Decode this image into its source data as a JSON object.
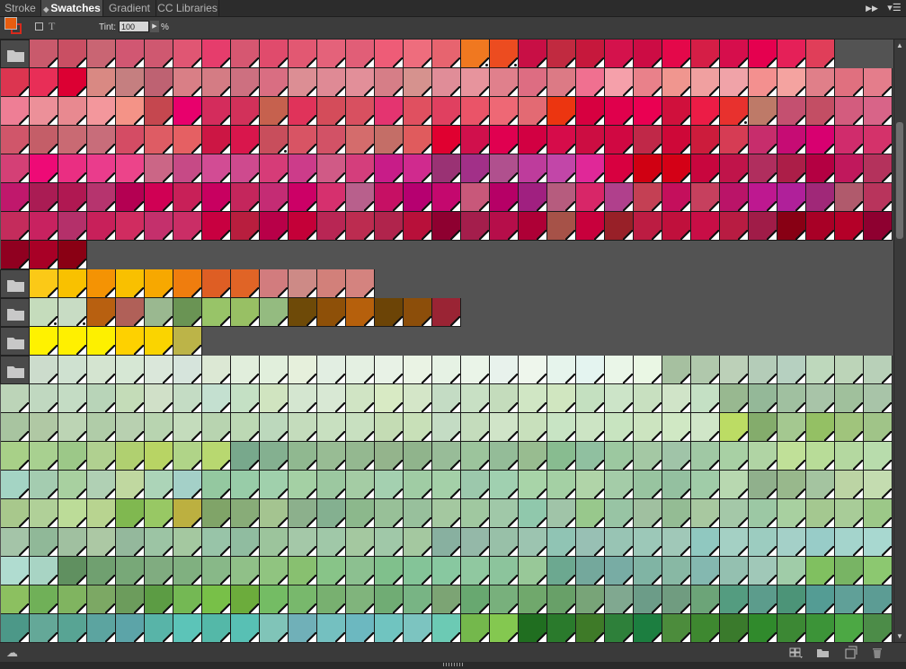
{
  "tabs": [
    {
      "label": "Stroke",
      "active": false
    },
    {
      "label": "Swatches",
      "active": true
    },
    {
      "label": "Gradient",
      "active": false
    },
    {
      "label": "CC Libraries",
      "active": false
    }
  ],
  "header": {
    "collapse_icon": "double-chevron-right-icon",
    "menu_icon": "panel-menu-icon"
  },
  "toolbar": {
    "fill_color": "#e85d0f",
    "stroke_color": "#d82a1c",
    "tint_label": "Tint:",
    "tint_value": "100",
    "tint_unit": "%"
  },
  "swatch_groups": [
    {
      "folder_icon": "folder-icon",
      "rows": [
        [
          "#c95a6c",
          "#c94f63",
          "#c96573",
          "#d15772",
          "#cf5870",
          "#e05673",
          "#e63d6c",
          "#d65771",
          "#e04b6c",
          "#e25872",
          "#e4627a",
          "#e15e77",
          "#ee5c77",
          "#ee6d7d",
          "#e7646f",
          "#f07820",
          "#ec4c20",
          "#c80f45",
          "#c12a40",
          "#c6183c",
          "#d4124c",
          "#cc0c44",
          "#e4084a",
          "#d51e46",
          "#d60e4c",
          "#e5004f",
          "#e52058",
          "#e03e59"
        ],
        [
          "#dc3550",
          "#e82e57",
          "#dc0033",
          "#d98983",
          "#c57f80",
          "#be6272",
          "#d97f86",
          "#d47c84",
          "#cd7080",
          "#d96e82",
          "#dc8e94",
          "#df8a95",
          "#e28f99",
          "#d67e87",
          "#d6928e",
          "#e08d98",
          "#e7949d",
          "#e0808c",
          "#dd6d82",
          "#dc7a85",
          "#f07090",
          "#f5a0aa",
          "#e9818a",
          "#f0968f",
          "#f0a0a0",
          "#f0a3a8",
          "#f3908f",
          "#f4a3a0",
          "#e07f89",
          "#e0707f",
          "#e47d8b"
        ],
        [
          "#ee7e95",
          "#ec9099",
          "#e88990",
          "#f3979c",
          "#f49387",
          "#c5474f",
          "#e8006c",
          "#d42c5c",
          "#d2315a",
          "#c6614e",
          "#e0335a",
          "#d44c5a",
          "#d85060",
          "#e43470",
          "#e05060",
          "#e04060",
          "#ea5468",
          "#ee6875",
          "#e36a73",
          "#ec3510",
          "#d70040",
          "#e0004c",
          "#ea0052",
          "#d0103c",
          "#ec1c46",
          "#e8312e",
          "#be7a68",
          "#c45070",
          "#c34e64",
          "#d35c7e",
          "#d86488"
        ],
        [
          "#d0566a",
          "#c45e68",
          "#c96a73",
          "#c86d7a",
          "#d44c64",
          "#de5c64",
          "#e56063",
          "#cc1644",
          "#d9164c",
          "#c84e5c",
          "#d85464",
          "#d25266",
          "#d46c6c",
          "#c46e67",
          "#e05b5d",
          "#e00030",
          "#d0104c",
          "#e00050",
          "#d20042",
          "#d60c4a",
          "#cc0d42",
          "#d00842",
          "#c02848",
          "#ce0838",
          "#cc1c3c",
          "#d63c54",
          "#c72d6c",
          "#c60c74",
          "#d80070",
          "#d02c6c",
          "#d4326a"
        ],
        [
          "#d44076",
          "#ee0a76",
          "#ea2e82",
          "#ea3c8c",
          "#ec448a",
          "#cb6686",
          "#c64a86",
          "#d24c94",
          "#ce4a8e",
          "#d63c78",
          "#cc3c8a",
          "#d05a86",
          "#d43e7c",
          "#c81c88",
          "#d02a8e",
          "#9a3274",
          "#a23088",
          "#b0508e",
          "#be3c9c",
          "#c246a8",
          "#e02898",
          "#d80040",
          "#d00012",
          "#d40016",
          "#c8063e",
          "#c0144a",
          "#b02e5e",
          "#ac1e48",
          "#b40042",
          "#c0185c",
          "#b4325c"
        ],
        [
          "#c0186c",
          "#aa1c54",
          "#b01852",
          "#b6346e",
          "#b40052",
          "#d00054",
          "#c82058",
          "#c80060",
          "#c4265c",
          "#c42c74",
          "#cc0066",
          "#d6306e",
          "#b8608c",
          "#c61064",
          "#b60070",
          "#c4086e",
          "#c8587a",
          "#b60066",
          "#a02080",
          "#b65c7e",
          "#d82668",
          "#b0408c",
          "#c44054",
          "#c40f5c",
          "#c6405e",
          "#ba1468",
          "#be1890",
          "#b0209a",
          "#a02878",
          "#b05a6c",
          "#b8345c"
        ],
        [
          "#c42c5c",
          "#c82260",
          "#b4306a",
          "#c8205a",
          "#d02c60",
          "#c4306c",
          "#ca2e66",
          "#c80040",
          "#b81e3e",
          "#b80048",
          "#c40038",
          "#b82654",
          "#bc2c50",
          "#b0244c",
          "#b8103a",
          "#8e0030",
          "#a41e4c",
          "#b60e4a",
          "#ae0036",
          "#a65248",
          "#c8003c",
          "#982028",
          "#bc1c42",
          "#c0103c",
          "#c80e46",
          "#b81c42",
          "#a01c48",
          "#880014",
          "#a80026",
          "#b40028",
          "#8e0030"
        ],
        [
          "#900020",
          "#a80026",
          "#8a0014"
        ]
      ]
    },
    {
      "folder_icon": "folder-icon",
      "rows": [
        [
          "#fbc917",
          "#f9c100",
          "#f49304",
          "#f9c000",
          "#f7a800",
          "#ef7d0e",
          "#de5e24",
          "#e06426",
          "#d27c7e",
          "#cd8a86",
          "#d2807a",
          "#d4837f"
        ]
      ]
    },
    {
      "folder_icon": "folder-icon",
      "rows": [
        [
          "#c5dcbc",
          "#c8dcc4",
          "#b86010",
          "#b06058",
          "#9ab890",
          "#6a9454",
          "#98c468",
          "#98c064",
          "#94bb80",
          "#6e4a08",
          "#8e5008",
          "#b6600c",
          "#6c4406",
          "#8c4e0a",
          "#9a2434"
        ]
      ]
    },
    {
      "folder_icon": "folder-icon",
      "rows": [
        [
          "#fff200",
          "#fff000",
          "#fdf000",
          "#fed100",
          "#fad400",
          "#bcb448"
        ]
      ]
    },
    {
      "folder_icon": "folder-icon",
      "rows": [
        [
          "#ccdccc",
          "#cfe1d0",
          "#d4e4d0",
          "#d6e7d4",
          "#dae7da",
          "#d6e4dc",
          "#dce8d4",
          "#e1eedc",
          "#e1efdc",
          "#e6f0dc",
          "#e2eee2",
          "#e4f0e2",
          "#e8f2e6",
          "#eaf3e4",
          "#e6f2e4",
          "#eaf4e8",
          "#e8f2ec",
          "#eef6ec",
          "#e6f4ec",
          "#e4f4f0",
          "#eaf6e8",
          "#eaf7e4",
          "#a6c0a0",
          "#b0c8ac",
          "#bcd0b8",
          "#b4ccb8",
          "#b6d0c0",
          "#bed8bc",
          "#bcd4b8",
          "#b8d0b8"
        ],
        [
          "#bcd4b8",
          "#c0d8c0",
          "#c4dcc4",
          "#b8d4b8",
          "#c4dcb8",
          "#d0e0c8",
          "#c4dcc4",
          "#c4e0d0",
          "#c4e0c4",
          "#d0e4c0",
          "#d4e6d0",
          "#d8e8d4",
          "#d0e4c4",
          "#d8eac4",
          "#d4e6c8",
          "#c4dcc4",
          "#c8e0c4",
          "#c4dcbc",
          "#d0e6c4",
          "#d0e6c0",
          "#c4e0c0",
          "#cce4c8",
          "#c8e0c0",
          "#d0e4c8",
          "#c4e0c4",
          "#98b890",
          "#94b898",
          "#a0c0a0",
          "#a8c4a8",
          "#a0c09c",
          "#a8c4a8"
        ],
        [
          "#a8c4a0",
          "#b0c8a4",
          "#bcd4b4",
          "#b0cca8",
          "#b8d0b0",
          "#b8d4b0",
          "#c4dcbc",
          "#b8d4b0",
          "#bcd8b4",
          "#bcd8bc",
          "#c4dcbc",
          "#c8e0c0",
          "#c8e0c0",
          "#c4dcb4",
          "#c8e0b8",
          "#c4dcc4",
          "#c4dcbc",
          "#d0e4c8",
          "#c8e0bc",
          "#c8e4c4",
          "#cce4c4",
          "#c8e4c0",
          "#cce4c0",
          "#d0e8c4",
          "#d0e6c8",
          "#bcdc64",
          "#84ac6c",
          "#a4c890",
          "#94c064",
          "#a0c47c",
          "#a0c488"
        ],
        [
          "#a8d088",
          "#a8d090",
          "#9cc888",
          "#b0d090",
          "#b0d070",
          "#b8d464",
          "#b0d488",
          "#b8d870",
          "#78a88c",
          "#84b090",
          "#90b890",
          "#98bc94",
          "#94b890",
          "#94b48c",
          "#90b48c",
          "#98bc98",
          "#9cc49c",
          "#94bc98",
          "#98bc90",
          "#88bc90",
          "#90c0a0",
          "#9cc8a0",
          "#a4c8a4",
          "#a0c4a8",
          "#a0c8a4",
          "#a8d0a4",
          "#b0d4a4",
          "#c0e098",
          "#b8dc98",
          "#b4d8a0",
          "#b8dcac"
        ],
        [
          "#a4d4c4",
          "#a4ccb0",
          "#a8d0a0",
          "#b0d0b4",
          "#c0d8a0",
          "#acd4b8",
          "#a4d0c8",
          "#94c8a0",
          "#98cca8",
          "#a0d0ac",
          "#a4d0a4",
          "#9cc8a0",
          "#a4cca4",
          "#a4d0b0",
          "#a0cca4",
          "#a4d0a8",
          "#9cc8ac",
          "#a0d0b0",
          "#a8d4a8",
          "#a4d0a4",
          "#b0d4a8",
          "#a4cca8",
          "#98c4a0",
          "#94c0a0",
          "#a0cca8",
          "#b8d8b0",
          "#90b08c",
          "#98b88c",
          "#a4c4a0",
          "#bcd4a4",
          "#c4dcb0"
        ],
        [
          "#a8c88c",
          "#b0d098",
          "#bcdc98",
          "#b8d490",
          "#80b850",
          "#98c864",
          "#bcb040",
          "#80a468",
          "#88ac78",
          "#a4c490",
          "#8cb08c",
          "#84b090",
          "#8cb88c",
          "#98c098",
          "#98c09c",
          "#a4c8a0",
          "#a0c8a0",
          "#a0c8a8",
          "#90c8ac",
          "#a0c4a8",
          "#98c88c",
          "#98c4a4",
          "#a0c0a0",
          "#94bc94",
          "#a8c8a0",
          "#a4c8a8",
          "#9cc8a4",
          "#a8d0a0",
          "#a4c890",
          "#a8cc98",
          "#9cc888"
        ],
        [
          "#a4c4a8",
          "#90b898",
          "#a0c0a0",
          "#acc8a4",
          "#94b89c",
          "#9cc4a4",
          "#a4c8a0",
          "#98c4a8",
          "#90bca0",
          "#9cc49c",
          "#a4c8a8",
          "#a0c8a8",
          "#a4c8a0",
          "#a0c8a8",
          "#a4c8a0",
          "#88b0a0",
          "#94b8a8",
          "#98c0a8",
          "#9cc4b0",
          "#90c4b4",
          "#98c0b4",
          "#98c4b4",
          "#9cc8b8",
          "#a0c8b8",
          "#90c8c0",
          "#a4d0c4",
          "#9cccc0",
          "#a4d0c8",
          "#98ccc8",
          "#a4d4cc",
          "#a8d8d0"
        ],
        [
          "#b0dcd0",
          "#a8d4c4",
          "#609060",
          "#70a070",
          "#78a878",
          "#80ac80",
          "#80b080",
          "#88b888",
          "#90c088",
          "#90c480",
          "#88c070",
          "#88c488",
          "#8cc090",
          "#80c08c",
          "#84c498",
          "#88c8a0",
          "#90c8a0",
          "#8cc49c",
          "#98c898",
          "#6ca890",
          "#74a89c",
          "#78aca4",
          "#80b4a4",
          "#88b8a4",
          "#84b8b0",
          "#94c0b0",
          "#a0c8b8",
          "#a0cca8",
          "#80c060",
          "#78b464",
          "#8cc870"
        ],
        [
          "#8cc060",
          "#70b058",
          "#80b460",
          "#7ca864",
          "#6c9c5c",
          "#5c9c44",
          "#74b854",
          "#78c048",
          "#6cac3c",
          "#74bc64",
          "#78b86c",
          "#78b070",
          "#80b47c",
          "#70ac74",
          "#78b484",
          "#7ca474",
          "#68a870",
          "#78b07c",
          "#70a86c",
          "#68a068",
          "#78a478",
          "#80a890",
          "#6c9c88",
          "#709c80",
          "#6ca478",
          "#549c80",
          "#5c9c8c",
          "#4c9478",
          "#549c94",
          "#60a098",
          "#5c9c94"
        ],
        [
          "#4c9888",
          "#64a898",
          "#58a494",
          "#5ca4a0",
          "#5ca4a8",
          "#58b4a8",
          "#5cc4b8",
          "#54b8a8",
          "#58c0b4",
          "#80c4b8",
          "#70b0b8",
          "#74c0c0",
          "#6cb8c0",
          "#70c4c0",
          "#7cc4c0",
          "#6ccab4",
          "#74b84c",
          "#84c850",
          "#206e20",
          "#2a7a2c",
          "#3e7a28",
          "#2e803a",
          "#1c7e40",
          "#4c8c3c",
          "#3e8830",
          "#3a7a2c",
          "#308a2c",
          "#3c8834",
          "#3c9438",
          "#4ca844",
          "#4c8c48"
        ]
      ]
    }
  ],
  "bottom": {
    "icons": [
      "cc-libraries-icon",
      "swatch-views-icon",
      "new-color-group-icon",
      "new-swatch-icon",
      "delete-swatch-icon"
    ]
  }
}
